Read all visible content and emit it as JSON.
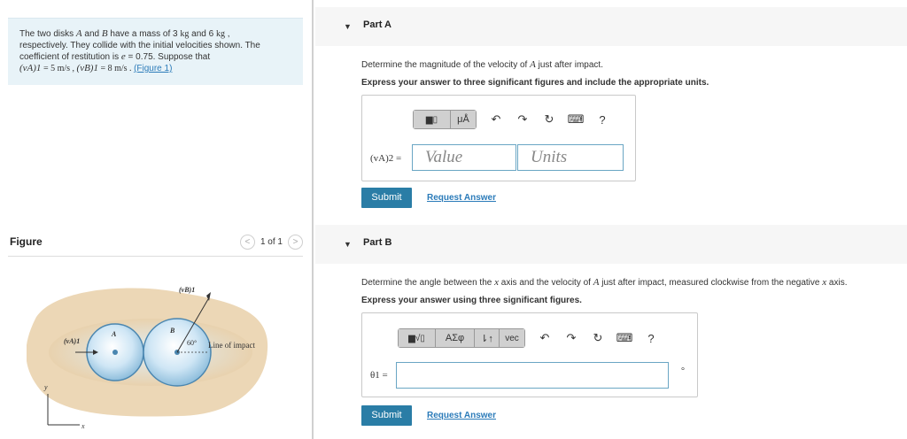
{
  "problem": {
    "line1_a": "The two disks ",
    "var_A": "A",
    "line1_b": " and ",
    "var_B": "B",
    "line1_c": " have a mass of 3  ",
    "unit_kg1": "kg",
    "line1_d": " and 6  ",
    "unit_kg2": "kg",
    "line1_e": " ,",
    "line2": "respectively. They collide with the initial velocities shown. The",
    "line3_a": "coefficient of restitution is ",
    "var_e": "e",
    "line3_b": " = 0.75. Suppose that",
    "vA1": "(vA)1",
    "eq1": " = 5  m/s , ",
    "vB1": "(vB)1",
    "eq2": " = 8  m/s . ",
    "figure_link": "(Figure 1)"
  },
  "figure_panel": {
    "title": "Figure",
    "pager_text": "1 of 1",
    "prev_glyph": "<",
    "next_glyph": ">",
    "labels": {
      "vB1": "(vB)1",
      "vA1": "(vA)1",
      "A": "A",
      "B": "B",
      "angle": "60°",
      "line_of_impact": "Line of impact",
      "y": "y",
      "x": "x"
    }
  },
  "partA": {
    "title": "Part A",
    "question_a": "Determine the magnitude of the velocity of ",
    "question_var": "A",
    "question_b": " just after impact.",
    "instruction": "Express your answer to three significant figures and include the appropriate units.",
    "toolbar": {
      "templates": "▆▯",
      "mu": "μÅ",
      "undo": "↶",
      "redo": "↷",
      "reset": "↻",
      "keyboard": "⌨",
      "help": "?"
    },
    "field_label": "(vA)2 =",
    "value_placeholder": "Value",
    "units_placeholder": "Units",
    "submit": "Submit",
    "request": "Request Answer"
  },
  "partB": {
    "title": "Part B",
    "question_a": "Determine the angle between the ",
    "question_x1": "x",
    "question_b": " axis and the velocity of ",
    "question_var": "A",
    "question_c": " just after impact, measured clockwise from the negative ",
    "question_x2": "x",
    "question_d": " axis.",
    "instruction": "Express your answer using three significant figures.",
    "toolbar": {
      "templates": "▆√▯",
      "greek": "ΑΣφ",
      "arrows": "⇂↑",
      "vec": "vec",
      "undo": "↶",
      "redo": "↷",
      "reset": "↻",
      "keyboard": "⌨",
      "help": "?"
    },
    "field_label": "θ1 =",
    "degree": "°",
    "submit": "Submit",
    "request": "Request Answer"
  }
}
